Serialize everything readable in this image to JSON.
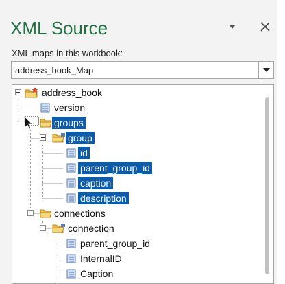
{
  "pane": {
    "title": "XML Source",
    "maps_label": "XML maps in this workbook:",
    "selected_map": "address_book_Map"
  },
  "tree": {
    "nodes": [
      {
        "label": "address_book",
        "type": "root-folder",
        "selected": false
      },
      {
        "label": "version",
        "type": "element",
        "selected": false
      },
      {
        "label": "groups",
        "type": "folder",
        "selected": true
      },
      {
        "label": "group",
        "type": "folder",
        "selected": true
      },
      {
        "label": "id",
        "type": "element",
        "selected": true
      },
      {
        "label": "parent_group_id",
        "type": "element",
        "selected": true
      },
      {
        "label": "caption",
        "type": "element",
        "selected": true
      },
      {
        "label": "description",
        "type": "element",
        "selected": true
      },
      {
        "label": "connections",
        "type": "folder",
        "selected": false
      },
      {
        "label": "connection",
        "type": "folder",
        "selected": false
      },
      {
        "label": "parent_group_id",
        "type": "element",
        "selected": false
      },
      {
        "label": "InternalID",
        "type": "element",
        "selected": false
      },
      {
        "label": "Caption",
        "type": "element",
        "selected": false
      }
    ]
  },
  "colors": {
    "title": "#217346",
    "selection": "#0b5cad",
    "folder": "#e8b64a",
    "element": "#5b7fb3"
  }
}
